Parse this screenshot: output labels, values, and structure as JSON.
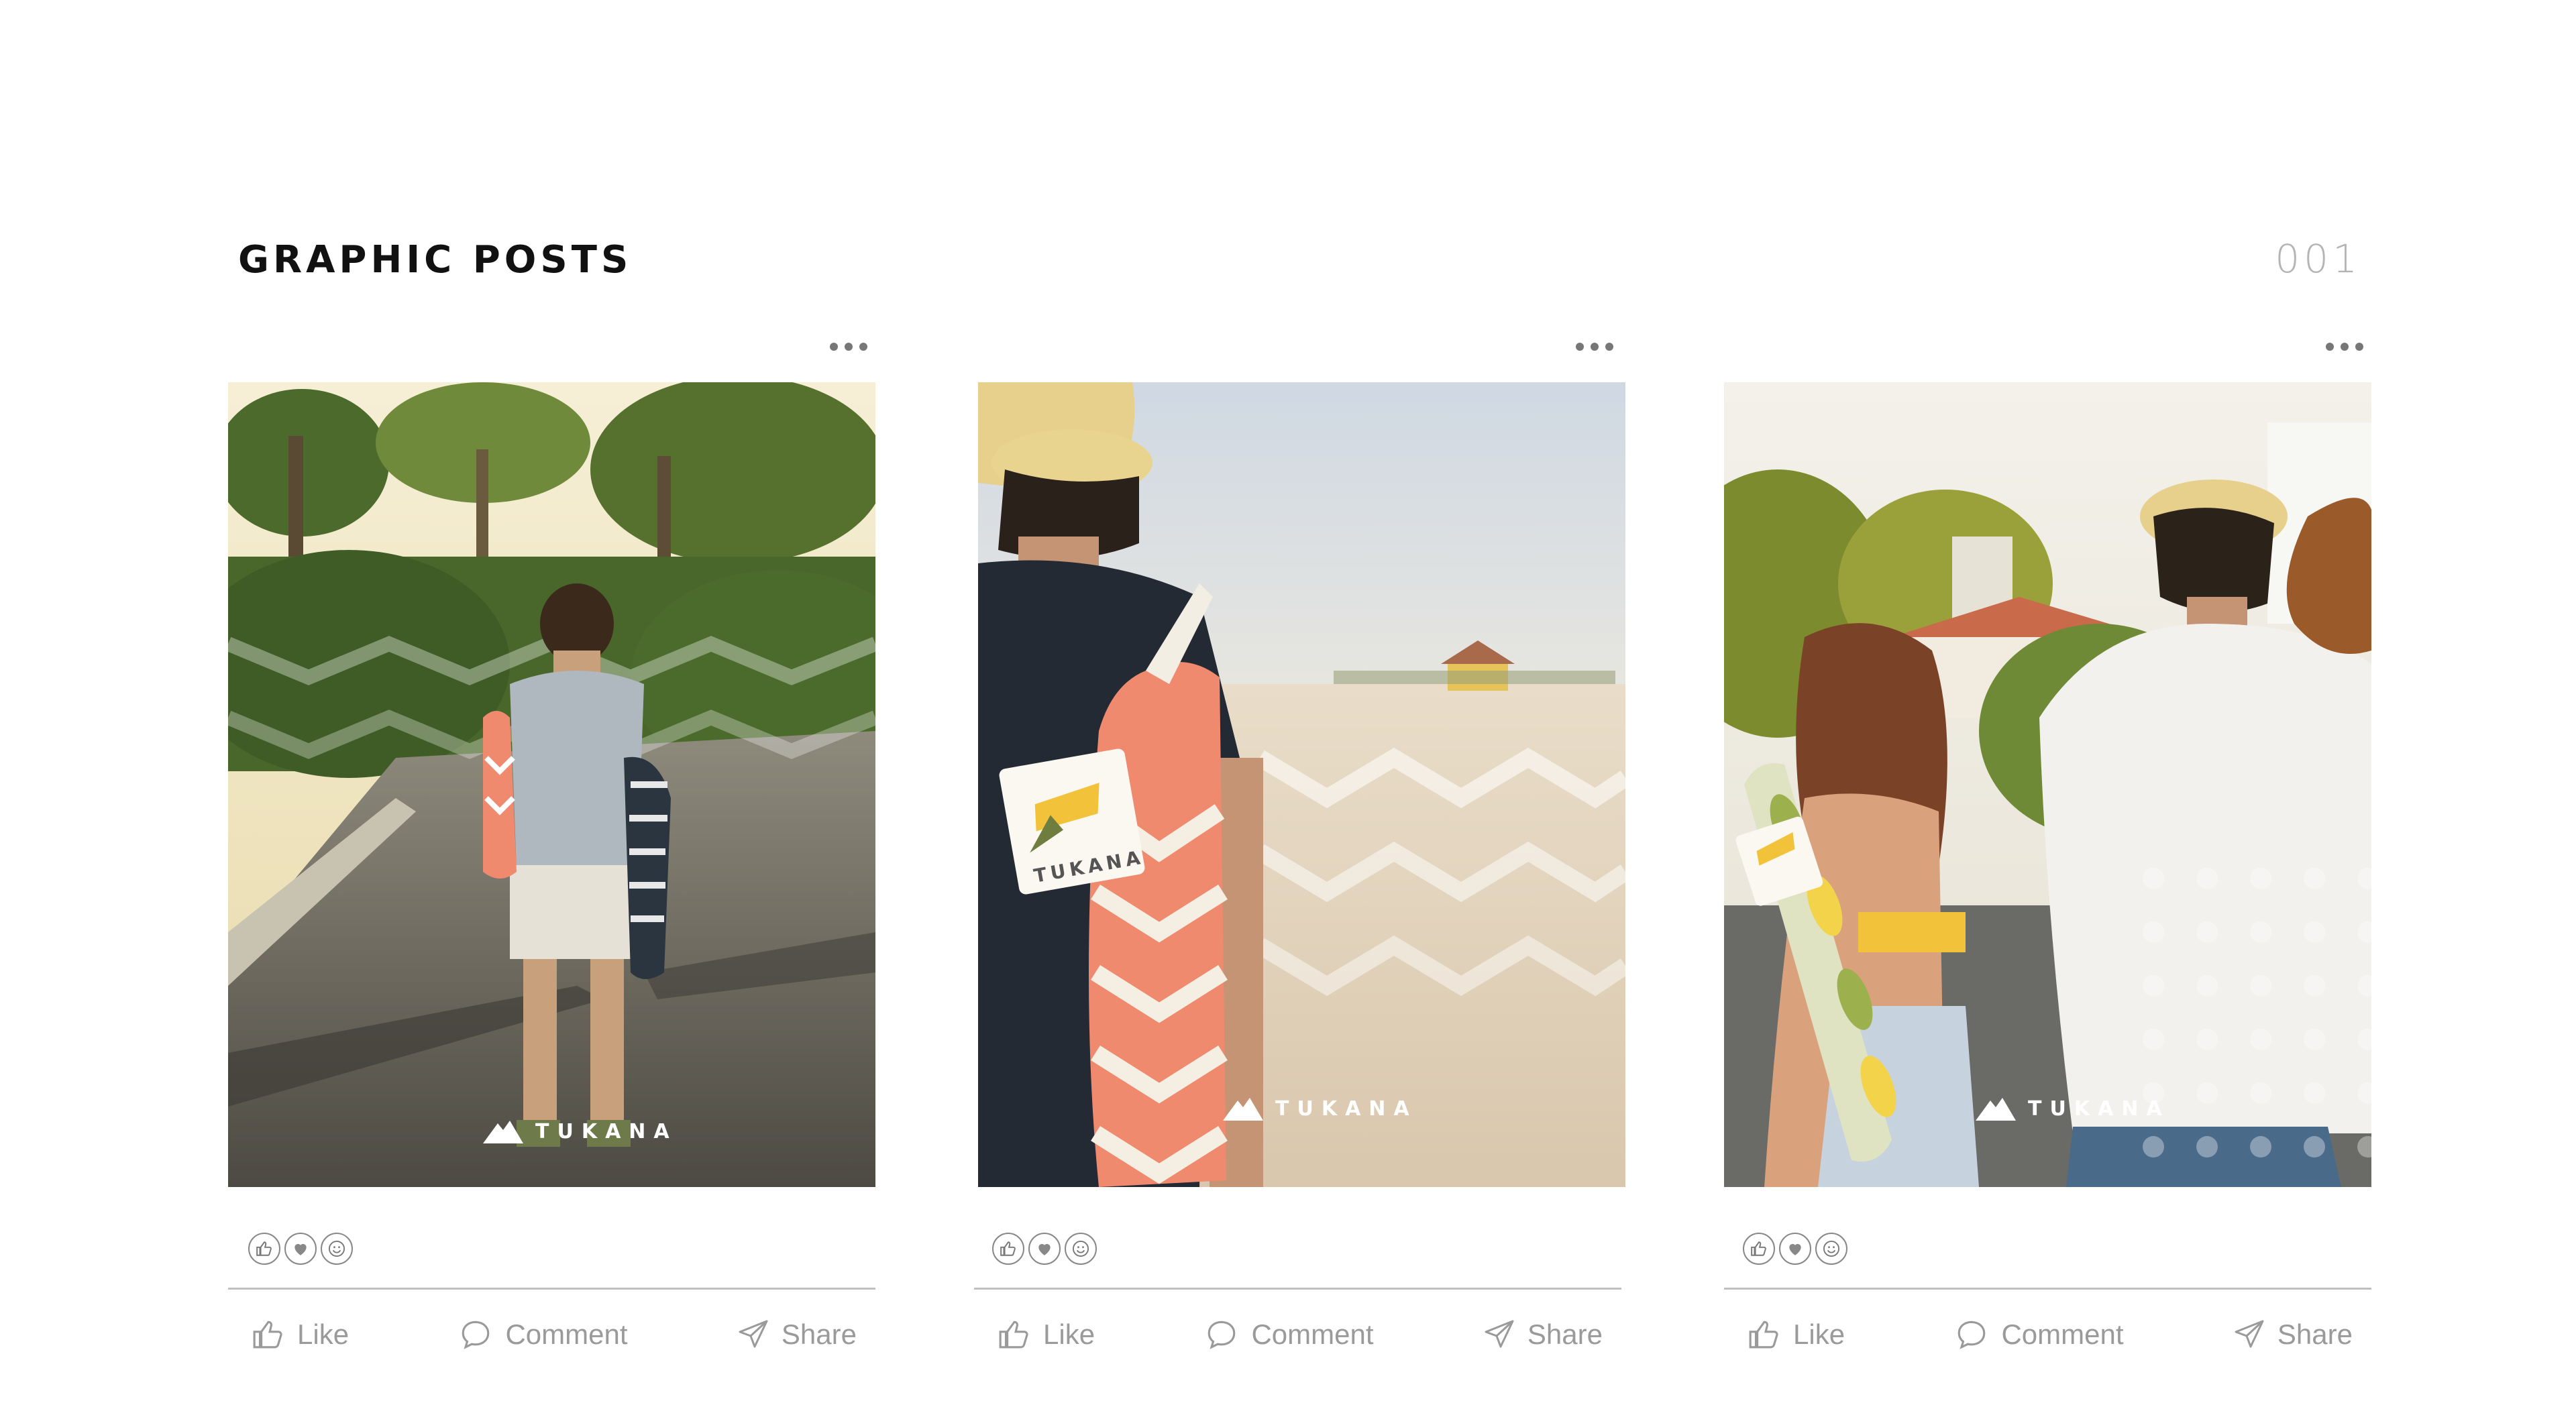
{
  "header": {
    "title": "GRAPHIC POSTS",
    "page_number": "001"
  },
  "colors": {
    "accent_coral": "#ef8a6e",
    "brand_yellow": "#f2c23a",
    "brand_green": "#6f7d3f",
    "text_muted": "#9a9a9a",
    "divider": "#bfbfbf"
  },
  "posts": [
    {
      "scene": "man walking down a sunlit tree-lined road carrying a coral chevron bag",
      "logo_text": "TUKANA",
      "reactions": [
        "thumbs-up-icon",
        "heart-icon",
        "smile-icon"
      ],
      "actions": {
        "like": "Like",
        "comment": "Comment",
        "share": "Share"
      }
    },
    {
      "scene": "man on a beach with a coral chevron drawstring bag over his shoulder",
      "logo_text": "TUKANA",
      "reactions": [
        "thumbs-up-icon",
        "heart-icon",
        "smile-icon"
      ],
      "actions": {
        "like": "Like",
        "comment": "Comment",
        "share": "Share"
      }
    },
    {
      "scene": "couple walking away on a street, woman carrying a green-yellow patterned bag",
      "logo_text": "TUKANA",
      "reactions": [
        "thumbs-up-icon",
        "heart-icon",
        "smile-icon"
      ],
      "actions": {
        "like": "Like",
        "comment": "Comment",
        "share": "Share"
      }
    }
  ]
}
